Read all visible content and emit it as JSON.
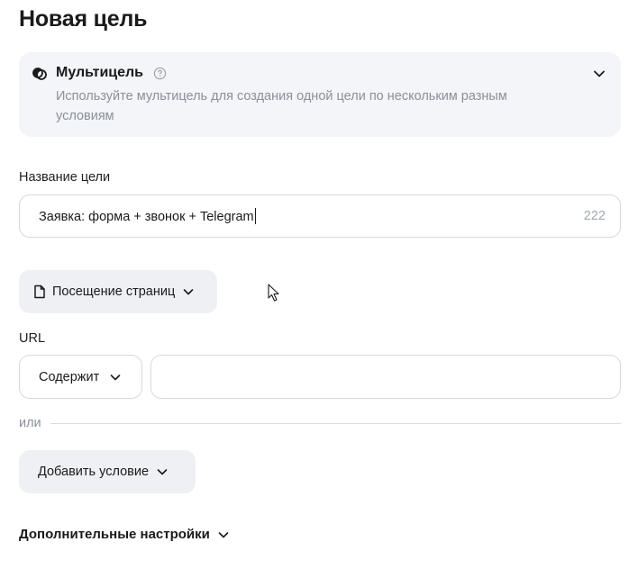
{
  "page": {
    "title": "Новая цель"
  },
  "multigoal": {
    "title": "Мультицель",
    "description": "Используйте мультицель для создания одной цели по нескольким разным условиям"
  },
  "goal_name": {
    "label": "Название цели",
    "value": "Заявка: форма + звонок + Telegram",
    "remaining_chars": "222"
  },
  "condition_type": {
    "label": "Посещение страниц"
  },
  "url": {
    "label": "URL",
    "match_mode": "Содержит",
    "value": ""
  },
  "or_divider": {
    "label": "или"
  },
  "add_condition": {
    "label": "Добавить условие"
  },
  "advanced": {
    "label": "Дополнительные настройки"
  },
  "colors": {
    "card_bg": "#f3f5f8",
    "pill_bg": "#eef0f4",
    "border": "#d6d9de",
    "muted_text": "#8a8f99"
  }
}
